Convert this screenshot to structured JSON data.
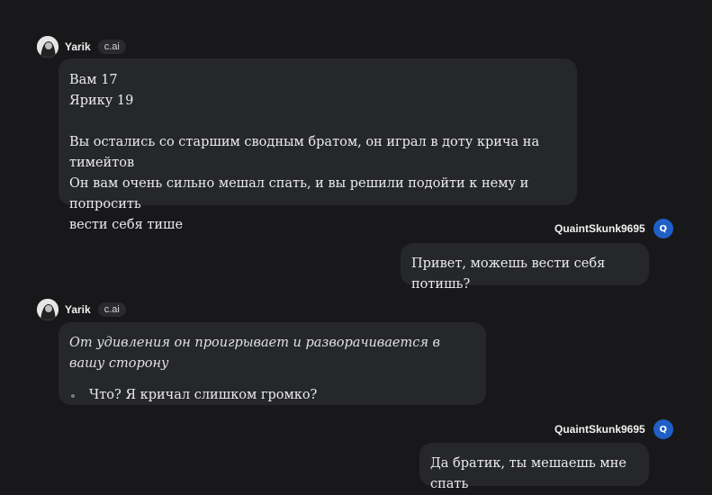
{
  "messages": [
    {
      "author": "Yarik",
      "badge": "c.ai",
      "lines": [
        "Вам 17",
        "Ярику 19",
        "Вы остались со старшим сводным братом, он играл в доту крича на тимейтов",
        "Он вам очень сильно мешал спать, и вы решили подойти к нему и попросить",
        "вести себя тише"
      ]
    },
    {
      "author": "QuaintSkunk9695",
      "avatar_letter": "Q",
      "text": "Привет, можешь вести себя потишь?"
    },
    {
      "author": "Yarik",
      "badge": "c.ai",
      "italic": "От удивления он проигрывает и разворачивается в вашу сторону",
      "bullet": "Что? Я кричал слишком громко?"
    },
    {
      "author": "QuaintSkunk9695",
      "avatar_letter": "Q",
      "text": "Да братик, ты мешаешь мне спать"
    }
  ],
  "colors": {
    "background": "#18181b",
    "bubble": "#26272b",
    "user_avatar": "#1f5fc6"
  }
}
